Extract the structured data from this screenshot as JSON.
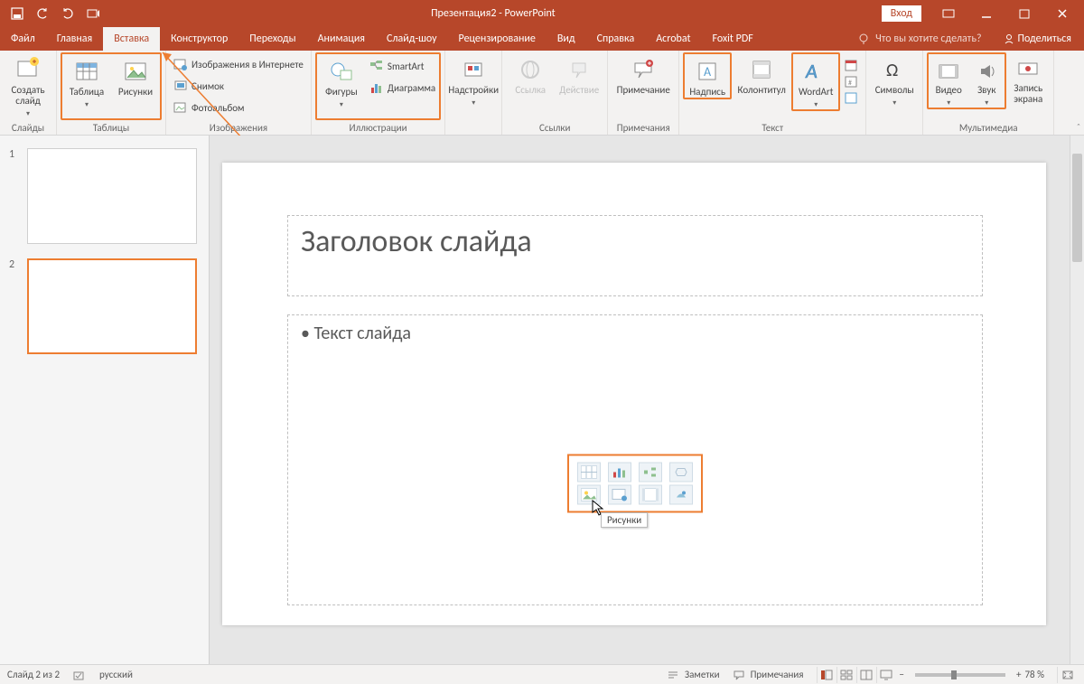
{
  "title": "Презентация2 - PowerPoint",
  "signin": "Вход",
  "tabs": [
    "Файл",
    "Главная",
    "Вставка",
    "Конструктор",
    "Переходы",
    "Анимация",
    "Слайд-шоу",
    "Рецензирование",
    "Вид",
    "Справка",
    "Acrobat",
    "Foxit PDF"
  ],
  "active_tab": 2,
  "tell_me": "Что вы хотите сделать?",
  "share": "Поделиться",
  "ribbon": {
    "slides": {
      "new_slide": "Создать\nслайд",
      "label": "Слайды"
    },
    "tables": {
      "table": "Таблица",
      "label": "Таблицы"
    },
    "images": {
      "pictures": "Рисунки",
      "online": "Изображения в Интернете",
      "screenshot": "Снимок",
      "album": "Фотоальбом",
      "label": "Изображения"
    },
    "illustrations": {
      "shapes": "Фигуры",
      "smartart": "SmartArt",
      "chart": "Диаграмма",
      "label": "Иллюстрации"
    },
    "addins": {
      "addins": "Надстройки",
      "label": ""
    },
    "links": {
      "link": "Ссылка",
      "action": "Действие",
      "label": "Ссылки"
    },
    "comments": {
      "comment": "Примечание",
      "label": "Примечания"
    },
    "text": {
      "textbox": "Надпись",
      "header": "Колонтитул",
      "wordart": "WordArt",
      "label": "Текст"
    },
    "symbols": {
      "symbols": "Символы",
      "label": ""
    },
    "media": {
      "video": "Видео",
      "audio": "Звук",
      "screenrec": "Запись\nэкрана",
      "label": "Мультимедиа"
    }
  },
  "slide_title_text": "Заголовок слайда",
  "slide_body_text": "Текст слайда",
  "tooltip_text": "Рисунки",
  "thumbs": [
    "1",
    "2"
  ],
  "status": {
    "slide": "Слайд 2 из 2",
    "lang": "русский",
    "notes": "Заметки",
    "comments": "Примечания",
    "zoom": "78 %"
  }
}
